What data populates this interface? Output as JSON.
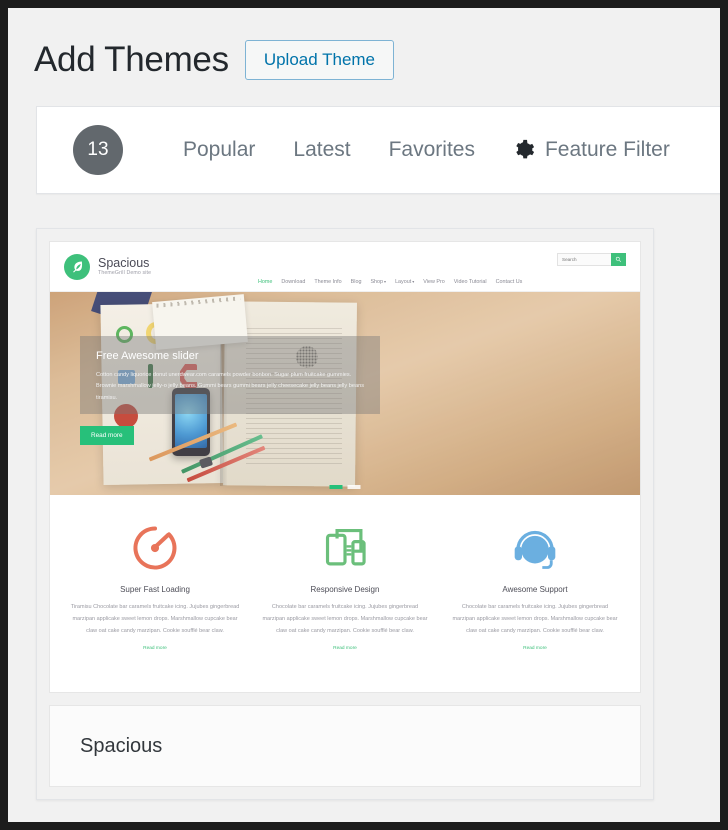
{
  "header": {
    "title": "Add Themes",
    "upload_button": "Upload Theme"
  },
  "filter_bar": {
    "count": "13",
    "tabs": [
      {
        "label": "Popular"
      },
      {
        "label": "Latest"
      },
      {
        "label": "Favorites"
      }
    ],
    "feature_filter": "Feature Filter",
    "gear_icon": "gear-icon"
  },
  "theme": {
    "name": "Spacious",
    "preview": {
      "site": {
        "name": "Spacious",
        "tagline": "ThemeGrill Demo site",
        "logo_icon": "leaf-icon",
        "nav": [
          {
            "label": "Home",
            "active": true,
            "caret": ""
          },
          {
            "label": "Download",
            "active": false,
            "caret": ""
          },
          {
            "label": "Theme Info",
            "active": false,
            "caret": ""
          },
          {
            "label": "Blog",
            "active": false,
            "caret": ""
          },
          {
            "label": "Shop",
            "active": false,
            "caret": "▾"
          },
          {
            "label": "Layout",
            "active": false,
            "caret": "▾"
          },
          {
            "label": "View Pro",
            "active": false,
            "caret": ""
          },
          {
            "label": "Video Tutorial",
            "active": false,
            "caret": ""
          },
          {
            "label": "Contact Us",
            "active": false,
            "caret": ""
          }
        ],
        "search": {
          "placeholder": "Search",
          "value": "",
          "button_icon": "search-icon"
        }
      },
      "slider": {
        "title": "Free Awesome slider",
        "text": "Cotton candy liquorice donut unerdwear.com caramels powder bonbon. Sugar plum fruitcake gummies. Brownie marshmallow jelly-o jelly beans. Gummi bears gummi bears jelly cheesecake jelly beans jelly beans tiramisu.",
        "button": "Read more",
        "slides": [
          {
            "active": true
          },
          {
            "active": false
          }
        ]
      },
      "features": [
        {
          "icon": "speedometer-icon",
          "color": "#e8745a",
          "title": "Super Fast Loading",
          "text": "Tiramisu Chocolate bar caramels fruitcake icing. Jujubes gingerbread marzipan applicake sweet lemon drops. Marshmallow cupcake bear claw oat cake candy marzipan. Cookie soufflé bear claw.",
          "link": "Read more"
        },
        {
          "icon": "responsive-devices-icon",
          "color": "#6bbf7b",
          "title": "Responsive Design",
          "text": "Chocolate bar caramels fruitcake icing. Jujubes gingerbread marzipan applicake sweet lemon drops. Marshmallow cupcake bear claw oat cake candy marzipan. Cookie soufflé bear claw.",
          "link": "Read more"
        },
        {
          "icon": "headset-support-icon",
          "color": "#6bafe0",
          "title": "Awesome Support",
          "text": "Chocolate bar caramels fruitcake icing. Jujubes gingerbread marzipan applicake sweet lemon drops. Marshmallow cupcake bear claw oat cake candy marzipan. Cookie soufflé bear claw.",
          "link": "Read more"
        }
      ]
    }
  },
  "colors": {
    "accent_green": "#3ec07b",
    "link_blue": "#0073aa",
    "badge_gray": "#62686d",
    "page_bg": "#f1f1f1"
  }
}
